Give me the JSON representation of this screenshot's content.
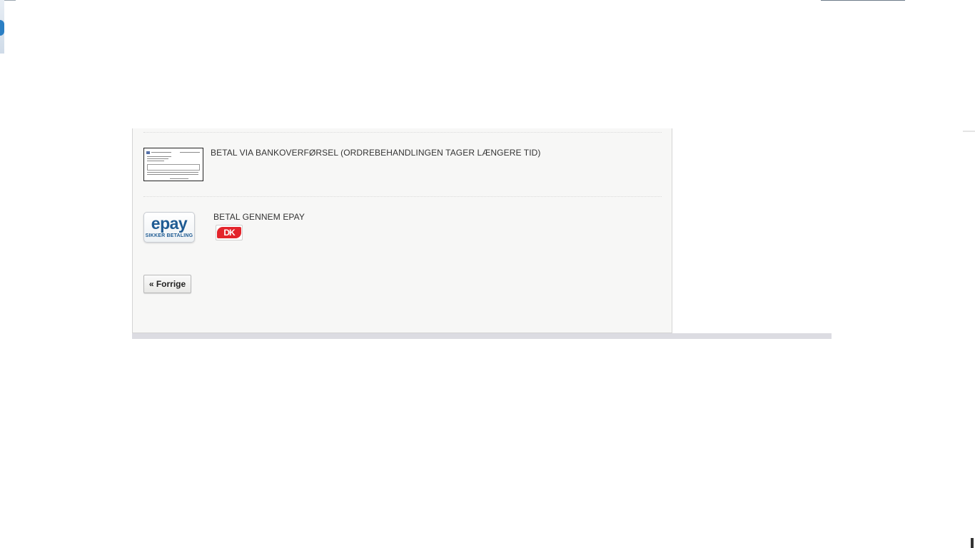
{
  "payment_methods": [
    {
      "label": "BETAL VIA BANKOVERFØRSEL (ORDREBEHANDLINGEN TAGER LÆNGERE TID)",
      "icon": "bank-transfer-invoice-icon"
    },
    {
      "label": "BETAL GENNEM EPAY",
      "icon": "epay-logo",
      "logo_word": "epay",
      "logo_tagline": "SIKKER BETALING",
      "card_icon": "dankort-icon",
      "card_text": "DK"
    }
  ],
  "buttons": {
    "previous_label": "« Forrige"
  },
  "colors": {
    "panel_background": "#f7f7f6",
    "epay_blue": "#1f5b93",
    "dankort_red": "#e3242b"
  }
}
